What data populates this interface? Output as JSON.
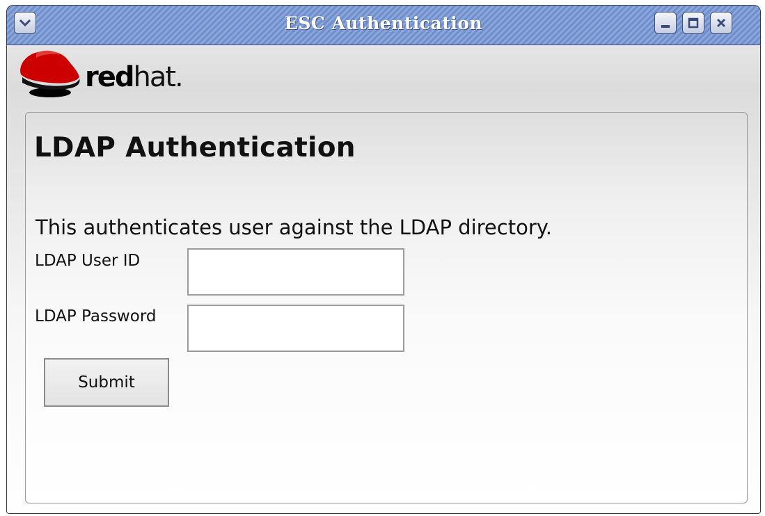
{
  "window": {
    "title": "ESC Authentication",
    "menu_icon": "chevron-down-icon",
    "minimize_icon": "minimize-icon",
    "maximize_icon": "maximize-icon",
    "close_icon": "close-icon"
  },
  "brand": {
    "logo_icon": "redhat-shadowman-logo",
    "name_bold": "red",
    "name_light": "hat.",
    "accent_color": "#cc0000"
  },
  "panel": {
    "heading": "LDAP Authentication",
    "description": "This authenticates user against the LDAP directory.",
    "fields": [
      {
        "label": "LDAP User ID",
        "value": "",
        "placeholder": ""
      },
      {
        "label": "LDAP Password",
        "value": "",
        "placeholder": ""
      }
    ],
    "submit_label": "Submit"
  }
}
